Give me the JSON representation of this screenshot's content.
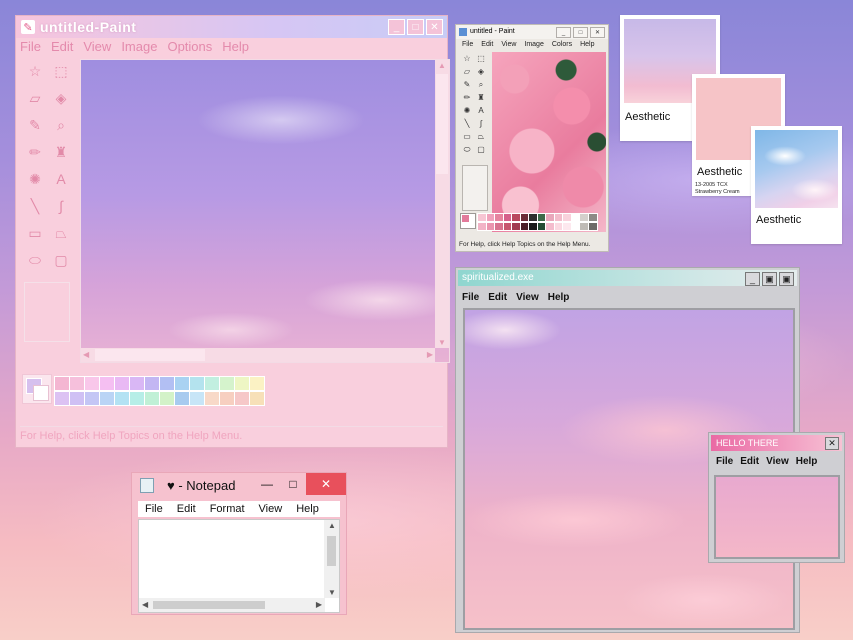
{
  "paint": {
    "title": "untitled-Paint",
    "menu": [
      "File",
      "Edit",
      "View",
      "Image",
      "Options",
      "Help"
    ],
    "tools": [
      {
        "icon": "free-select-icon",
        "glyph": "☆"
      },
      {
        "icon": "rect-select-icon",
        "glyph": "⬚"
      },
      {
        "icon": "eraser-icon",
        "glyph": "▱"
      },
      {
        "icon": "fill-icon",
        "glyph": "◈"
      },
      {
        "icon": "color-picker-icon",
        "glyph": "✎"
      },
      {
        "icon": "magnifier-icon",
        "glyph": "⌕"
      },
      {
        "icon": "pencil-icon",
        "glyph": "✏"
      },
      {
        "icon": "brush-icon",
        "glyph": "♜"
      },
      {
        "icon": "airbrush-icon",
        "glyph": "✺"
      },
      {
        "icon": "text-icon",
        "glyph": "A"
      },
      {
        "icon": "line-icon",
        "glyph": "╲"
      },
      {
        "icon": "curve-icon",
        "glyph": "∫"
      },
      {
        "icon": "rectangle-icon",
        "glyph": "▭"
      },
      {
        "icon": "polygon-icon",
        "glyph": "⏢"
      },
      {
        "icon": "ellipse-icon",
        "glyph": "⬭"
      },
      {
        "icon": "rounded-rect-icon",
        "glyph": "▢"
      }
    ],
    "palette": [
      "#f4b6d2",
      "#f6c0dc",
      "#f9c7ea",
      "#f5bff2",
      "#e9b9f4",
      "#d9b7f5",
      "#c3b6f3",
      "#b2bff3",
      "#a9d2f2",
      "#b4e3ee",
      "#c2efe0",
      "#d5f3cc",
      "#eef6c4",
      "#fbf2c4",
      "#dcc2f3",
      "#cfc0f4",
      "#c4c6f5",
      "#bad4f5",
      "#b3e2f3",
      "#b6eee7",
      "#c0f0d6",
      "#d3f2c8",
      "#a8cbef",
      "#c7e5f7",
      "#f8d9c8",
      "#f7cfc0",
      "#f6c8c8",
      "#f7e0b8"
    ],
    "status": "For Help, click Help Topics on the Help Menu."
  },
  "small_paint": {
    "title": "untitled - Paint",
    "menu": [
      "File",
      "Edit",
      "View",
      "Image",
      "Colors",
      "Help"
    ],
    "tools": [
      "☆",
      "⬚",
      "▱",
      "◈",
      "✎",
      "⌕",
      "✏",
      "♜",
      "✺",
      "A",
      "╲",
      "∫",
      "▭",
      "⏢",
      "⬭",
      "▢"
    ],
    "palette": [
      "#f7c5d3",
      "#f0a2bb",
      "#e6849f",
      "#d6608b",
      "#b9485e",
      "#6b2b36",
      "#2f2f2f",
      "#3d6b4a",
      "#e9a7bb",
      "#f3bccb",
      "#f9d2dc",
      "#ffffff",
      "#d4d0cc",
      "#8d8a86",
      "#f2b3c6",
      "#ea95ae",
      "#d8738f",
      "#c7566f",
      "#a13c51",
      "#4a1f27",
      "#1b1b1b",
      "#244b33",
      "#f4bccd",
      "#fbd9e2",
      "#fde8ee",
      "#ffffff",
      "#bfbbb6",
      "#6d6a67"
    ],
    "status": "For Help, click Help Topics on the Help Menu."
  },
  "polaroids": [
    {
      "caption": "Aesthetic"
    },
    {
      "caption": "Aesthetic",
      "sub": "13-2005 TCX\nStrawberry Cream"
    },
    {
      "caption": "Aesthetic"
    }
  ],
  "spirit": {
    "title": "spiritualized.exe",
    "menu": [
      "File",
      "Edit",
      "View",
      "Help"
    ]
  },
  "hello": {
    "title": "HELLO THERE",
    "menu": [
      "File",
      "Edit",
      "View",
      "Help"
    ]
  },
  "notepad": {
    "title": "♥ - Notepad",
    "menu": [
      "File",
      "Edit",
      "Format",
      "View",
      "Help"
    ]
  },
  "colors": {
    "paint_title_start": "#f7c5dc",
    "spirit_title": "#8fd6cf",
    "hello_title": "#ea6aa4",
    "notepad_close": "#e8505c"
  }
}
